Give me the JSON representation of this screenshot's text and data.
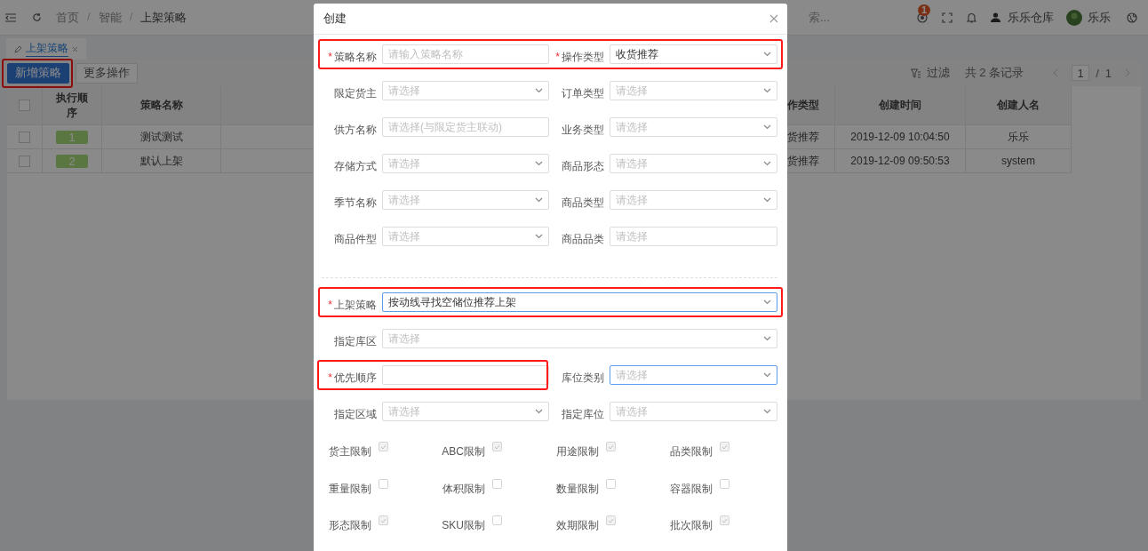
{
  "header": {
    "breadcrumb": [
      {
        "label": "首页"
      },
      {
        "separator": "/",
        "label": "智能"
      },
      {
        "separator": "/",
        "label": "上架策略"
      }
    ],
    "search": {
      "placeholder": "索..."
    },
    "notification_count": "1",
    "warehouse": "乐乐仓库",
    "user": "乐乐"
  },
  "tabs": [
    {
      "label": "上架策略",
      "selected": true
    }
  ],
  "toolbar": {
    "buttons": [
      {
        "label": "新增策略",
        "kind": "primary",
        "highlighted": true
      },
      {
        "label": "更多操作",
        "kind": "default",
        "highlighted": false
      }
    ],
    "filter": "过滤",
    "record_count": "共 2 条记录",
    "pagination": {
      "page": "1",
      "separator": "/",
      "total": "1"
    }
  },
  "table": {
    "all_checked": false,
    "columns": [
      "执行顺序",
      "策略名称",
      "作类型",
      "创建时间",
      "创建人名"
    ],
    "rows": [
      {
        "checked": false,
        "order": "1",
        "name": "测试测试",
        "operation_type": "货推荐",
        "created_at": "2019-12-09 10:04:50",
        "creator": "乐乐"
      },
      {
        "checked": false,
        "order": "2",
        "name": "默认上架",
        "operation_type": "货推荐",
        "created_at": "2019-12-09 09:50:53",
        "creator": "system"
      }
    ]
  },
  "modal": {
    "title": "创建",
    "sections": [
      {
        "rows": [
          {
            "fields": [
              {
                "label": "策略名称",
                "required_mark": "*",
                "kind": "input",
                "placeholder": "请输入策略名称",
                "focused": false,
                "highlighted": true
              },
              {
                "label": "操作类型",
                "required_mark": "*",
                "kind": "select",
                "value": "收货推荐",
                "focused": false,
                "highlighted": true
              }
            ]
          },
          {
            "fields": [
              {
                "label": "限定货主",
                "kind": "select",
                "placeholder": "请选择",
                "focused": false,
                "highlighted": false
              },
              {
                "label": "订单类型",
                "kind": "select",
                "placeholder": "请选择",
                "focused": false,
                "highlighted": false
              }
            ]
          },
          {
            "fields": [
              {
                "label": "供方名称",
                "kind": "input",
                "placeholder": "请选择(与限定货主联动)",
                "focused": false,
                "highlighted": false
              },
              {
                "label": "业务类型",
                "kind": "select",
                "placeholder": "请选择",
                "focused": false,
                "highlighted": false
              }
            ]
          },
          {
            "fields": [
              {
                "label": "存储方式",
                "kind": "select",
                "placeholder": "请选择",
                "focused": false,
                "highlighted": false
              },
              {
                "label": "商品形态",
                "kind": "select",
                "placeholder": "请选择",
                "focused": false,
                "highlighted": false
              }
            ]
          },
          {
            "fields": [
              {
                "label": "季节名称",
                "kind": "select",
                "placeholder": "请选择",
                "focused": false,
                "highlighted": false
              },
              {
                "label": "商品类型",
                "kind": "select",
                "placeholder": "请选择",
                "focused": false,
                "highlighted": false
              }
            ]
          },
          {
            "fields": [
              {
                "label": "商品件型",
                "kind": "select",
                "placeholder": "请选择",
                "focused": false,
                "highlighted": false
              },
              {
                "label": "商品品类",
                "kind": "input",
                "placeholder": "请选择",
                "focused": false,
                "highlighted": false
              }
            ]
          }
        ]
      },
      {
        "rows": [
          {
            "fields": [
              {
                "label": "上架策略",
                "required_mark": "*",
                "kind": "select",
                "value": "按动线寻找空储位推荐上架",
                "focused": true,
                "highlighted": true
              }
            ]
          },
          {
            "fields": [
              {
                "label": "指定库区",
                "kind": "select",
                "placeholder": "请选择",
                "focused": false,
                "highlighted": false
              }
            ]
          },
          {
            "fields": [
              {
                "label": "优先顺序",
                "required_mark": "*",
                "kind": "input",
                "focused": false,
                "highlighted": true
              },
              {
                "label": "库位类别",
                "kind": "select",
                "placeholder": "请选择",
                "focused": true,
                "highlighted": false
              }
            ]
          },
          {
            "fields": [
              {
                "label": "指定区域",
                "kind": "select",
                "placeholder": "请选择",
                "focused": false,
                "highlighted": false
              },
              {
                "label": "指定库位",
                "kind": "select",
                "placeholder": "请选择",
                "focused": false,
                "highlighted": false
              }
            ]
          }
        ]
      }
    ],
    "checkboxes": [
      {
        "label": "货主限制",
        "checked": true
      },
      {
        "label": "ABC限制",
        "checked": true
      },
      {
        "label": "用途限制",
        "checked": true
      },
      {
        "label": "品类限制",
        "checked": true
      },
      {
        "label": "重量限制",
        "checked": false
      },
      {
        "label": "体积限制",
        "checked": false
      },
      {
        "label": "数量限制",
        "checked": false
      },
      {
        "label": "容器限制",
        "checked": false
      },
      {
        "label": "形态限制",
        "checked": true
      },
      {
        "label": "SKU限制",
        "checked": false
      },
      {
        "label": "效期限制",
        "checked": true
      },
      {
        "label": "批次限制",
        "checked": true
      }
    ]
  }
}
